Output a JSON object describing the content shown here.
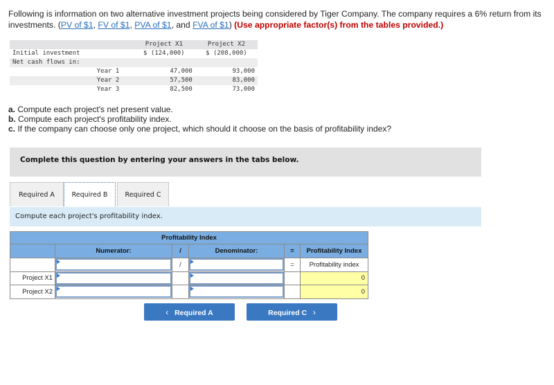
{
  "intro": {
    "text_before": "Following is information on two alternative investment projects being considered by Tiger Company. The company requires a 6% return from its investments. (",
    "links": [
      "PV of $1",
      "FV of $1",
      "PVA of $1",
      "FVA of $1"
    ],
    "sep1": ", ",
    "sep2": ", ",
    "sep3": ", and ",
    "close_paren": ") ",
    "instruction": "(Use appropriate factor(s) from the tables provided.)"
  },
  "investment_table": {
    "headers": [
      "",
      "",
      "Project X1",
      "Project X2"
    ],
    "rows": [
      {
        "label": "Initial investment",
        "sub": "",
        "x1": "$ (124,000)",
        "x2": "$ (208,000)"
      },
      {
        "label": "Net cash flows in:",
        "sub": "",
        "x1": "",
        "x2": ""
      },
      {
        "label": "",
        "sub": "Year 1",
        "x1": "47,000",
        "x2": "93,000"
      },
      {
        "label": "",
        "sub": "Year 2",
        "x1": "57,500",
        "x2": "83,000"
      },
      {
        "label": "",
        "sub": "Year 3",
        "x1": "82,500",
        "x2": "73,000"
      }
    ]
  },
  "questions": [
    {
      "letter": "a.",
      "text": " Compute each project's net present value."
    },
    {
      "letter": "b.",
      "text": " Compute each project's profitability index."
    },
    {
      "letter": "c.",
      "text": " If the company can choose only one project, which should it choose on the basis of profitability index?"
    }
  ],
  "banner": "Complete this question by entering your answers in the tabs below.",
  "tabs": [
    {
      "label": "Required A",
      "active": false
    },
    {
      "label": "Required B",
      "active": true
    },
    {
      "label": "Required C",
      "active": false
    }
  ],
  "instruction": "Compute each project's profitability index.",
  "pi_table": {
    "title": "Profitability Index",
    "headers": {
      "numerator": "Numerator:",
      "slash": "/",
      "denominator": "Denominator:",
      "equals": "=",
      "result": "Profitability Index"
    },
    "formula_row": {
      "label": "",
      "numerator": "",
      "slash": "/",
      "denominator": "",
      "equals": "=",
      "result": "Profitability index"
    },
    "rows": [
      {
        "label": "Project X1",
        "numerator": "",
        "denominator": "",
        "result": "0"
      },
      {
        "label": "Project X2",
        "numerator": "",
        "denominator": "",
        "result": "0"
      }
    ]
  },
  "nav": {
    "prev_label": "Required A",
    "prev_icon": "‹",
    "next_label": "Required C",
    "next_icon": "›"
  }
}
